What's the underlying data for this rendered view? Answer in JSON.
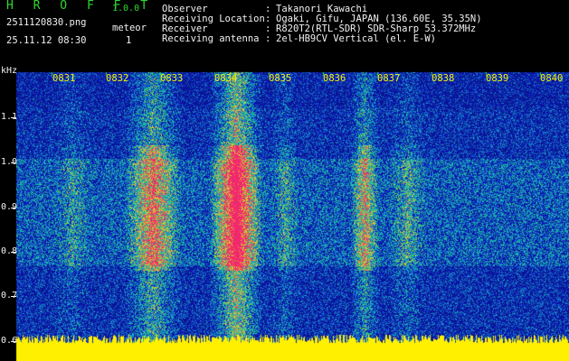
{
  "header": {
    "brand": "H R O F F T",
    "version": "1.0.0",
    "filename": "2511120830.png",
    "datetime": "25.11.12 08:30",
    "meteor_label": "meteor",
    "meteor_count": "1"
  },
  "station_info": [
    {
      "key": "Observer",
      "value": "Takanori Kawachi"
    },
    {
      "key": "Receiving Location",
      "value": "Ogaki, Gifu, JAPAN (136.60E, 35.35N)"
    },
    {
      "key": "Receiver",
      "value": "R820T2(RTL-SDR) SDR-Sharp 53.372MHz"
    },
    {
      "key": "Receiving antenna",
      "value": "2el-HB9CV Vertical (el. E-W)"
    }
  ],
  "separator": ":",
  "y_axis": {
    "unit": "kHz",
    "ticks": [
      "1.1",
      "1.0",
      "0.9",
      "0.8",
      "0.7",
      "0.6"
    ]
  },
  "x_axis": {
    "ticks": [
      "0831",
      "0832",
      "0833",
      "0834",
      "0835",
      "0836",
      "0837",
      "0838",
      "0839",
      "0840"
    ]
  },
  "colors": {
    "background": "#000000",
    "label_green": "#2fd82f",
    "tick_yellow": "#f6f600",
    "spectrum_low": "#0a1aa8",
    "spectrum_mid": "#1fb8c8",
    "spectrum_high": "#f0306a",
    "baseline": "#ffff00"
  }
}
